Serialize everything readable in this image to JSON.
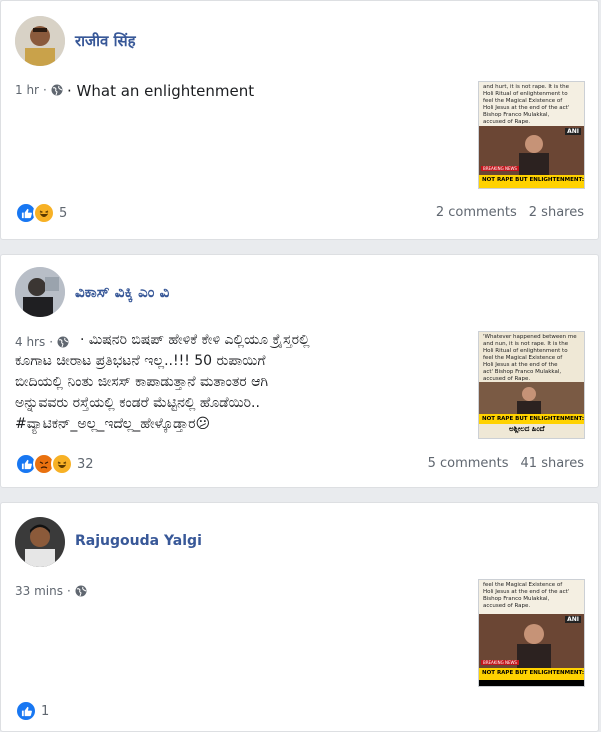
{
  "posts": [
    {
      "author": "राजीव सिंह",
      "time": "1 hr",
      "separator": "·",
      "privacy_icon": "globe-icon",
      "text": "· What an enlightenment",
      "thumbnail": {
        "text": "and hurt, it is not rape. It is the\nHoli Ritual of enlightenment to\nfeel the Magical Existence of\nHoli Jesus at the end of the act'\nBishop Franco Mulakkal,\naccused of Rape.",
        "tag": "BREAKING NEWS",
        "banner": "NOT RAPE BUT ENLIGHTENMENT: BIS",
        "logo": "ANI"
      },
      "reactions": [
        "like",
        "haha"
      ],
      "reaction_count": "5",
      "comments": "2 comments",
      "shares": "2 shares"
    },
    {
      "author": "ವಿಕಾಸ್ ವಿಕ್ಕಿ ಎಂ ವಿ",
      "time": "4 hrs",
      "separator": "·",
      "privacy_icon": "globe-icon",
      "text_lines": [
        "· ಮಿಷನರಿ ಬಿಷಪ್ ಹೇಳಿಕೆ ಕೇಳಿ ಎಲ್ಲಿಯೂ ಕ್ರೈಸ್ತರಲ್ಲಿ",
        "ಕೂಗಾಟ ಚೀರಾಟ ಪ್ರತಿಭಟನೆ ಇಲ್ಲ..!!! 50 ರುಪಾಯಿಗೆ",
        "ಬೀದಿಯಲ್ಲಿ ನಿಂತು ಜೀಸಸ್ ಕಾಪಾಡುತ್ತಾನೆ ಮತಾಂತರ ಆಗಿ",
        "ಅನ್ನುವವರು ರಸ್ತೆಯಲ್ಲಿ ಕಂಡರೆ ಮೆಟ್ಟಿನಲ್ಲಿ ಹೊಡೆಯಿರಿ..",
        "#ವ್ಯಾಟಿಕನ್_ಅಲ್ಲ_ಇದೆಲ್ಲ_ಹೇಳ್ಕೊಡ್ತಾರ😕"
      ],
      "thumbnail": {
        "text": "'Whatever happened between me\nand nun, it is not rape. It is the\nHoli Ritual of enlightenment to\nfeel the Magical Existence of\nHoli Jesus at the end of the\nact' Bishop Franco Mulakkal,\naccused of Rape.",
        "banner": "NOT RAPE BUT ENLIGHTENMENT: BI",
        "caption": "ಅಶ್ಲೀಲದ ಹಿಂದೆ"
      },
      "reactions": [
        "like",
        "angry",
        "haha"
      ],
      "reaction_count": "32",
      "comments": "5 comments",
      "shares": "41 shares"
    },
    {
      "author": "Rajugouda Yalgi",
      "time": "33 mins",
      "separator": "·",
      "privacy_icon": "globe-icon",
      "thumbnail": {
        "text": "feel the Magical Existence of\nHoli Jesus at the end of the act'\nBishop Franco Mulakkal,\naccused of Rape.",
        "tag": "BREAKING NEWS",
        "banner": "NOT RAPE BUT ENLIGHTENMENT: BIS",
        "logo": "ANI"
      },
      "reactions": [
        "like"
      ],
      "reaction_count": "1"
    }
  ]
}
